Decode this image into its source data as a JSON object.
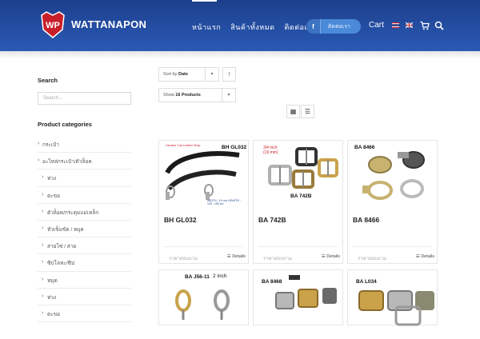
{
  "header": {
    "brand": "WATTANAPON",
    "logo_text": "WP",
    "nav": [
      "หน้าแรก",
      "สินค้าทั้งหมด",
      "ติดต่อเรา"
    ],
    "facebook_label": "ติดต่อเรา",
    "facebook_icon": "f",
    "cart_label": "Cart",
    "colors": {
      "header_top": "#1d3f8c",
      "header_bottom": "#2a5ab5",
      "logo_red": "#c8202a"
    }
  },
  "sidebar": {
    "search_title": "Search",
    "search_placeholder": "Search...",
    "categories_title": "Product categories",
    "categories": [
      {
        "label": "กระเป๋า",
        "level": "top"
      },
      {
        "label": "อะไหล่กระเป๋า/ตัวล็อค",
        "level": "top"
      },
      {
        "label": "ห่วง",
        "level": "sub"
      },
      {
        "label": "ตะขอ",
        "level": "sub"
      },
      {
        "label": "ตัวล็อค/กระดุมแม่เหล็ก",
        "level": "sub"
      },
      {
        "label": "หัวเข็มขัด / หมุด",
        "level": "sub"
      },
      {
        "label": "สายโซ่ / สาย",
        "level": "sub"
      },
      {
        "label": "ซิปโลหะ/ซิป",
        "level": "sub"
      },
      {
        "label": "หมุด",
        "level": "sub"
      },
      {
        "label": "ห่วง",
        "level": "sub"
      },
      {
        "label": "ตะขอ",
        "level": "sub"
      }
    ]
  },
  "toolbar": {
    "sort_prefix": "Sort by",
    "sort_value": "Date",
    "show_prefix": "Show",
    "show_value": "16 Products",
    "caret": "▾",
    "direction_arrow": "↑",
    "grid_icon": "▦",
    "list_icon": "☰"
  },
  "products": [
    {
      "title": "BH GL032",
      "image_code": "BH GL032",
      "price": "ราคาสอบถาม",
      "details": "Details",
      "caption_red": "Genuine Cow Leather Strap",
      "caption_dims": "WIDTH : 1.9 cm LENGTH : 120 - 150 cm"
    },
    {
      "title": "BA 742B",
      "image_code": "BA 742B",
      "price": "ราคาสอบถาม",
      "details": "Details",
      "caption_red": "3/4 inch (19 mm)"
    },
    {
      "title": "BA 8466",
      "image_code": "BA 8466",
      "price": "ราคาสอบถาม",
      "details": "Details"
    },
    {
      "title": "BA J56-11",
      "image_code": "BA J56-11",
      "image_sub": "2 inch"
    },
    {
      "title": "BA 8468",
      "image_code": "BA 8468"
    },
    {
      "title": "BA L034",
      "image_code": "BA L034"
    }
  ]
}
